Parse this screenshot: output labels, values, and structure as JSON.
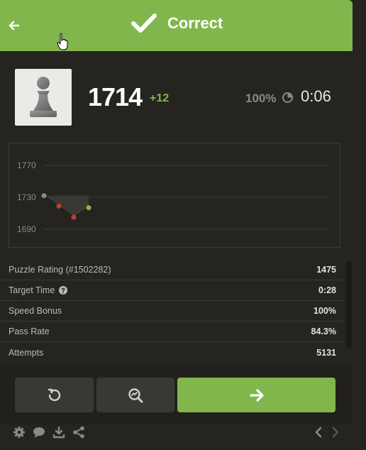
{
  "header": {
    "title": "Correct",
    "color": "#81b64c"
  },
  "player": {
    "avatar_icon": "pawn-icon",
    "rating": "1714",
    "delta": "+12",
    "accuracy": "100%",
    "time": "0:06"
  },
  "chart_data": {
    "type": "line",
    "y_ticks": [
      "1770",
      "1730",
      "1690"
    ],
    "ylim": [
      1670,
      1790
    ],
    "points": [
      {
        "x": 0,
        "y": 1732,
        "color": "gray"
      },
      {
        "x": 1,
        "y": 1719,
        "color": "red"
      },
      {
        "x": 2,
        "y": 1705,
        "color": "red"
      },
      {
        "x": 3,
        "y": 1717,
        "color": "green"
      }
    ],
    "grid": true
  },
  "stats": [
    {
      "label": "Puzzle Rating (#1502282)",
      "value": "1475"
    },
    {
      "label": "Target Time",
      "value": "0:28"
    },
    {
      "label": "Speed Bonus",
      "value": "100%"
    },
    {
      "label": "Pass Rate",
      "value": "84.3%"
    },
    {
      "label": "Attempts",
      "value": "5131"
    }
  ],
  "actions": {
    "retry_icon": "retry-icon",
    "analyze_icon": "analyze-icon",
    "next_icon": "arrow-right-icon"
  },
  "footer": {
    "icons": [
      "gear-icon",
      "chat-icon",
      "download-icon",
      "share-icon",
      "chevron-left-icon",
      "chevron-right-icon"
    ]
  }
}
